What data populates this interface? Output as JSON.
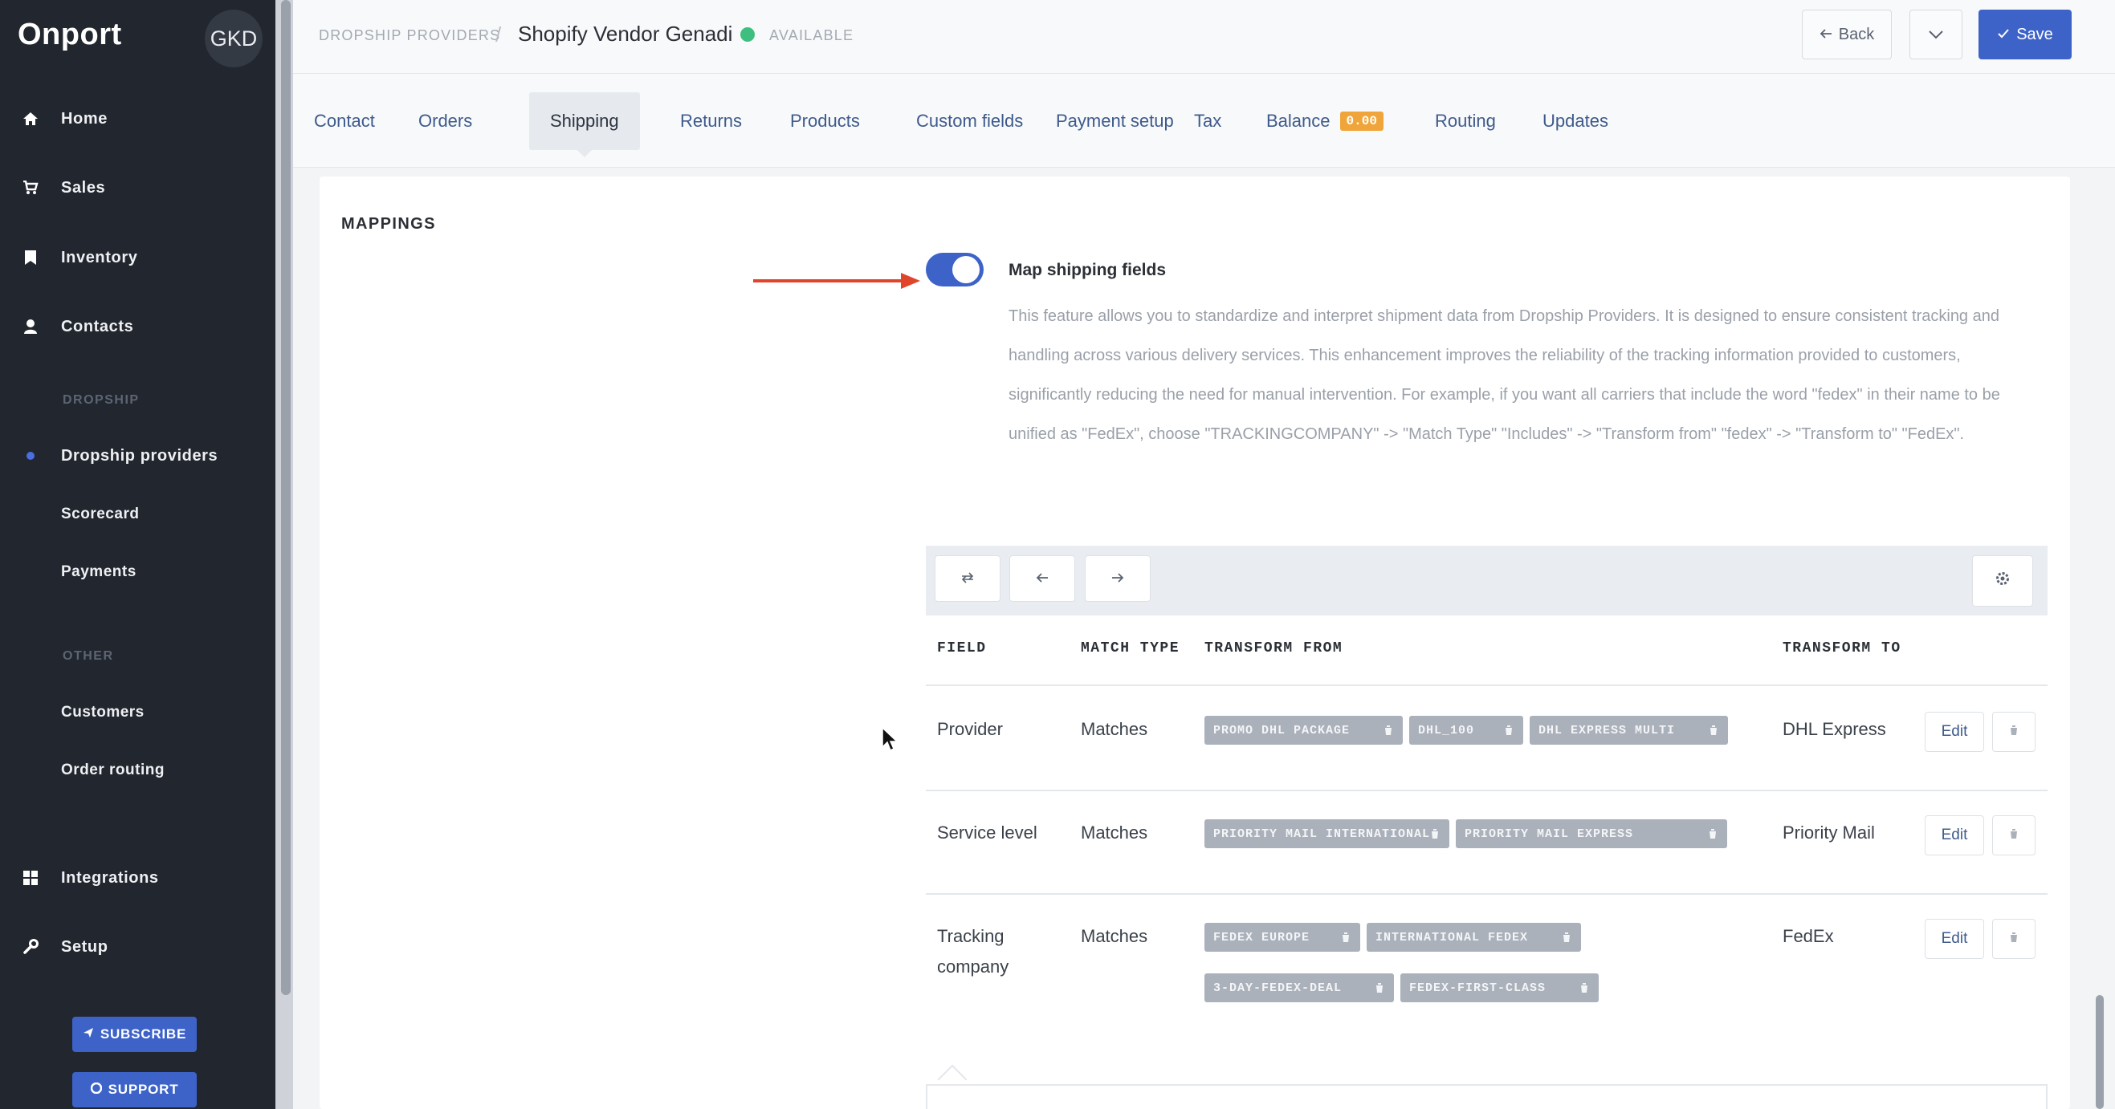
{
  "sidebar": {
    "brand": "Onport",
    "org_initials": "GKD",
    "items": [
      {
        "label": "Home",
        "icon": "home-icon"
      },
      {
        "label": "Sales",
        "icon": "cart-icon"
      },
      {
        "label": "Inventory",
        "icon": "bookmark-icon"
      },
      {
        "label": "Contacts",
        "icon": "user-icon"
      }
    ],
    "dropship_section": "DROPSHIP",
    "dropship_items": [
      "Dropship providers",
      "Scorecard",
      "Payments"
    ],
    "other_section": "OTHER",
    "other_items": [
      "Customers",
      "Order routing"
    ],
    "bottom_items": [
      {
        "label": "Integrations",
        "icon": "grid-icon"
      },
      {
        "label": "Setup",
        "icon": "wrench-icon"
      }
    ],
    "subscribe_label": "SUBSCRIBE",
    "support_label": "SUPPORT"
  },
  "header": {
    "breadcrumb": "DROPSHIP PROVIDERS",
    "separator": "/",
    "title": "Shopify Vendor Genadi",
    "status": "AVAILABLE",
    "back_label": "Back",
    "save_label": "Save",
    "accent_color": "#3d63c9"
  },
  "tabs": [
    {
      "label": "Contact"
    },
    {
      "label": "Orders"
    },
    {
      "label": "Shipping",
      "active": true
    },
    {
      "label": "Returns"
    },
    {
      "label": "Products"
    },
    {
      "label": "Custom fields"
    },
    {
      "label": "Payment setup"
    },
    {
      "label": "Tax"
    },
    {
      "label": "Balance",
      "badge": "0.00"
    },
    {
      "label": "Routing"
    },
    {
      "label": "Updates"
    }
  ],
  "mappings": {
    "section_title": "MAPPINGS",
    "toggle_label": "Map shipping fields",
    "toggle_on": true,
    "description": "This feature allows you to standardize and interpret shipment data from Dropship Providers. It is designed to ensure consistent tracking and handling across various delivery services. This enhancement improves the reliability of the tracking information provided to customers, significantly reducing the need for manual intervention. For example, if you want all carriers that include the word \"fedex\" in their name to be unified as \"FedEx\", choose \"TRACKINGCOMPANY\" -> \"Match Type\" \"Includes\" -> \"Transform from\" \"fedex\" -> \"Transform to\" \"FedEx\".",
    "columns": [
      "FIELD",
      "MATCH TYPE",
      "TRANSFORM FROM",
      "TRANSFORM TO"
    ],
    "rows": [
      {
        "field": "Provider",
        "match_type": "Matches",
        "transform_from": [
          "PROMO DHL PACKAGE",
          "DHL_100",
          "DHL EXPRESS MULTI"
        ],
        "transform_to": "DHL Express"
      },
      {
        "field": "Service level",
        "match_type": "Matches",
        "transform_from": [
          "PRIORITY MAIL INTERNATIONAL",
          "PRIORITY MAIL EXPRESS"
        ],
        "transform_to": "Priority Mail"
      },
      {
        "field": "Tracking company",
        "match_type": "Matches",
        "transform_from": [
          "FEDEX EUROPE",
          "INTERNATIONAL FEDEX",
          "3-DAY-FEDEX-DEAL",
          "FEDEX-FIRST-CLASS"
        ],
        "transform_to": "FedEx"
      }
    ],
    "edit_label": "Edit"
  }
}
